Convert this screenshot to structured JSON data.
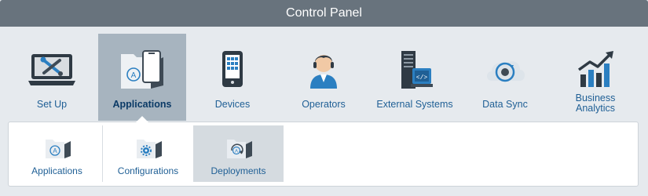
{
  "window": {
    "title": "Control Panel"
  },
  "nav": {
    "items": [
      {
        "label": "Set Up",
        "icon": "setup-tools-icon"
      },
      {
        "label": "Applications",
        "icon": "applications-icon",
        "active": true
      },
      {
        "label": "Devices",
        "icon": "device-phone-icon"
      },
      {
        "label": "Operators",
        "icon": "operator-person-icon"
      },
      {
        "label": "External Systems",
        "icon": "external-systems-icon"
      },
      {
        "label": "Data Sync",
        "icon": "data-sync-cloud-icon"
      },
      {
        "label": "Business Analytics",
        "icon": "business-analytics-icon"
      }
    ]
  },
  "subnav": {
    "items": [
      {
        "label": "Applications",
        "icon": "app-folder-icon"
      },
      {
        "label": "Configurations",
        "icon": "config-folder-icon"
      },
      {
        "label": "Deployments",
        "icon": "deploy-folder-icon",
        "active": true
      }
    ]
  },
  "colors": {
    "titlebar": "#68737d",
    "active_tab": "#a7b4bf",
    "label_blue": "#1f5f95",
    "icon_dark": "#3e4a55",
    "accent_blue": "#2b7fc1"
  }
}
